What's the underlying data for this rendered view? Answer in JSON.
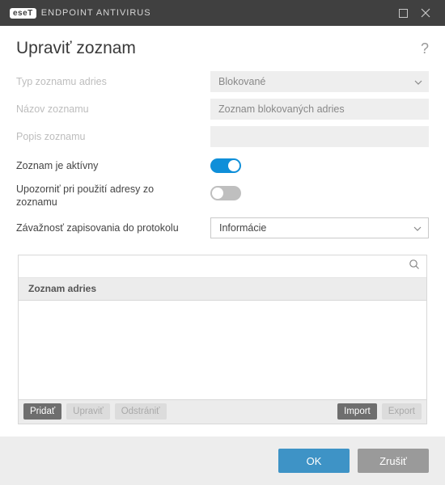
{
  "titlebar": {
    "logo_badge": "eseT",
    "logo_text": "ENDPOINT ANTIVIRUS"
  },
  "heading": "Upraviť zoznam",
  "help_symbol": "?",
  "fields": {
    "type_label": "Typ zoznamu adries",
    "type_value": "Blokované",
    "name_label": "Názov zoznamu",
    "name_value": "Zoznam blokovaných adries",
    "desc_label": "Popis zoznamu",
    "desc_value": "",
    "active_label": "Zoznam je aktívny",
    "notify_label": "Upozorniť pri použití adresy zo zoznamu",
    "severity_label": "Závažnosť zapisovania do protokolu",
    "severity_value": "Informácie"
  },
  "toggles": {
    "active": true,
    "notify": false
  },
  "listbox": {
    "search_placeholder": "",
    "header": "Zoznam adries"
  },
  "list_buttons": {
    "add": "Pridať",
    "edit": "Upraviť",
    "delete": "Odstrániť",
    "import": "Import",
    "export": "Export"
  },
  "footer": {
    "ok": "OK",
    "cancel": "Zrušiť"
  }
}
